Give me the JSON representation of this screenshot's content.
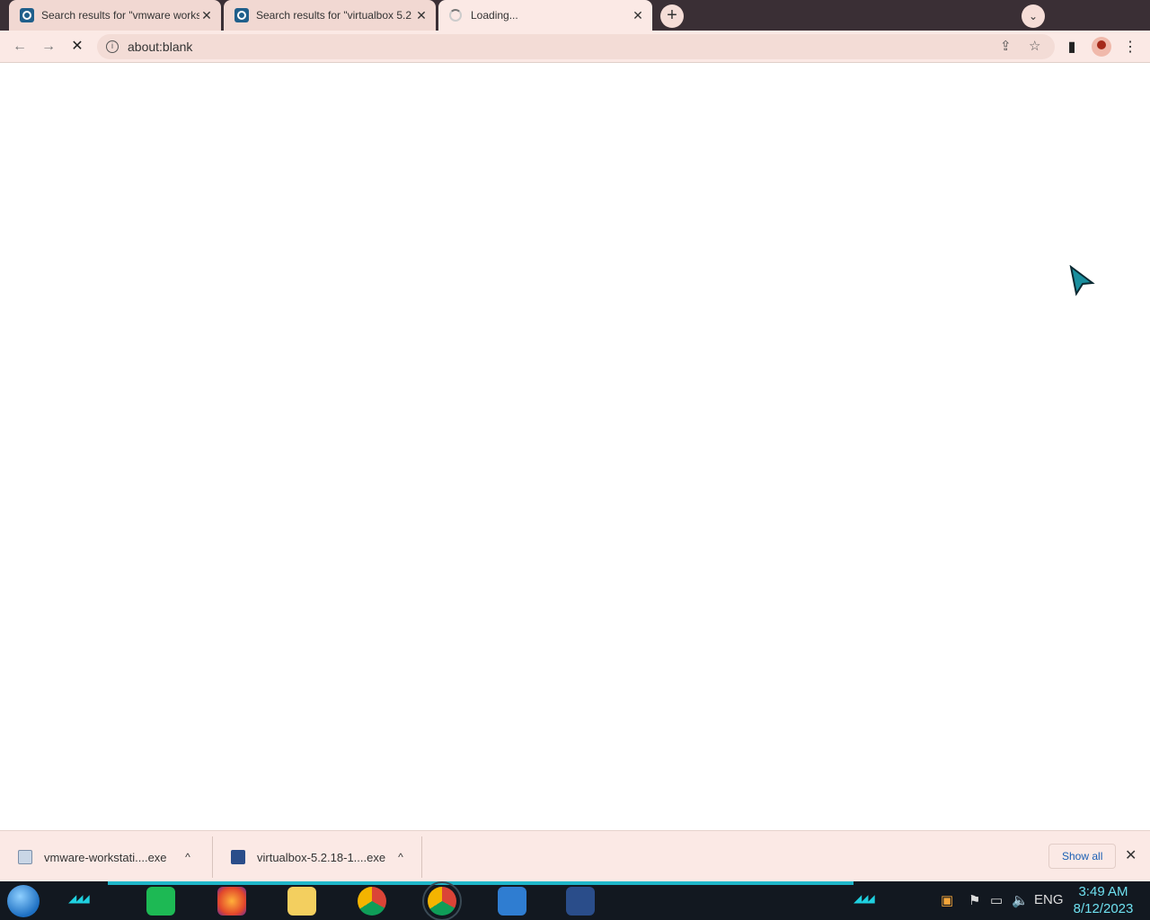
{
  "browser": {
    "tabs": [
      {
        "title": "Search results for \"vmware works",
        "close": "✕"
      },
      {
        "title": "Search results for \"virtualbox 5.2",
        "close": "✕"
      },
      {
        "title": "Loading...",
        "close": "✕"
      }
    ],
    "new_tab": "+",
    "tab_menu": "⌄"
  },
  "toolbar": {
    "back": "←",
    "forward": "→",
    "stop": "✕",
    "info": "i",
    "url": "about:blank",
    "share": "⇪",
    "bookmark": "☆",
    "side_panel": "▮",
    "menu": "⋮"
  },
  "downloads": {
    "items": [
      {
        "name": "vmware-workstati....exe",
        "chevron": "^",
        "icon": "vmware-installer-icon"
      },
      {
        "name": "virtualbox-5.2.18-1....exe",
        "chevron": "^",
        "icon": "virtualbox-icon"
      }
    ],
    "show_all": "Show all",
    "close": "✕"
  },
  "taskbar": {
    "language": "ENG",
    "time": "3:49 AM",
    "date": "8/12/2023"
  },
  "colors": {
    "tab_bg": "#f5ddd7",
    "frame": "#3a2f35",
    "toolbar": "#fbe9e5",
    "accent": "#1fb6c9"
  }
}
